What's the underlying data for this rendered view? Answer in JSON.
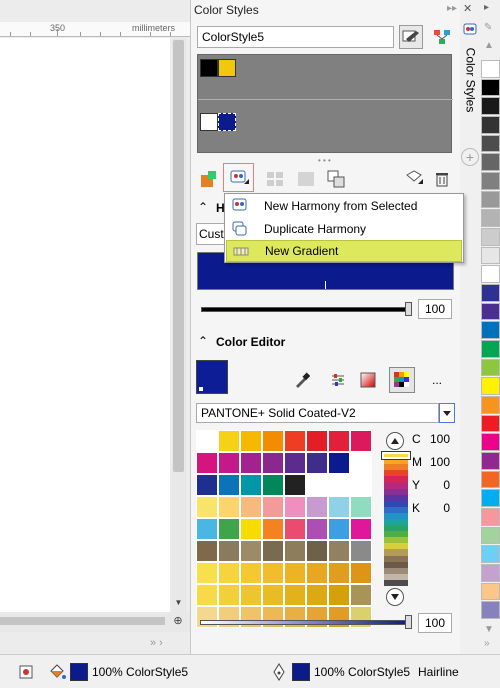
{
  "ruler": {
    "number": "350",
    "unit": "millimeters"
  },
  "docker": {
    "title": "Color Styles",
    "style_name": "ColorStyle5",
    "vertical_tab": "Color Styles"
  },
  "menu": {
    "items": [
      {
        "label": "New Harmony from Selected",
        "icon": "harmony-icon",
        "highlighted": false
      },
      {
        "label": "Duplicate Harmony",
        "icon": "duplicate-harmony-icon",
        "highlighted": false
      },
      {
        "label": "New Gradient",
        "icon": "gradient-icon",
        "highlighted": true
      }
    ]
  },
  "harmony": {
    "section_letter": "H",
    "dropdown_partial": "Cust",
    "slider_value": "100"
  },
  "color_editor": {
    "title": "Color Editor",
    "more_label": "...",
    "palette": "PANTONE+ Solid Coated-V2",
    "cmyk": [
      {
        "channel": "C",
        "value": "100"
      },
      {
        "channel": "M",
        "value": "100"
      },
      {
        "channel": "Y",
        "value": "0"
      },
      {
        "channel": "K",
        "value": "0"
      }
    ],
    "tint_value": "100"
  },
  "status": {
    "fill_label": "100% ColorStyle5",
    "outline_label": "100% ColorStyle5",
    "outline_width": "Hairline"
  },
  "colors": {
    "accent_blue": "#0b1a8c",
    "menu_highlight": "#dde85c",
    "panel_gray": "#808080"
  }
}
